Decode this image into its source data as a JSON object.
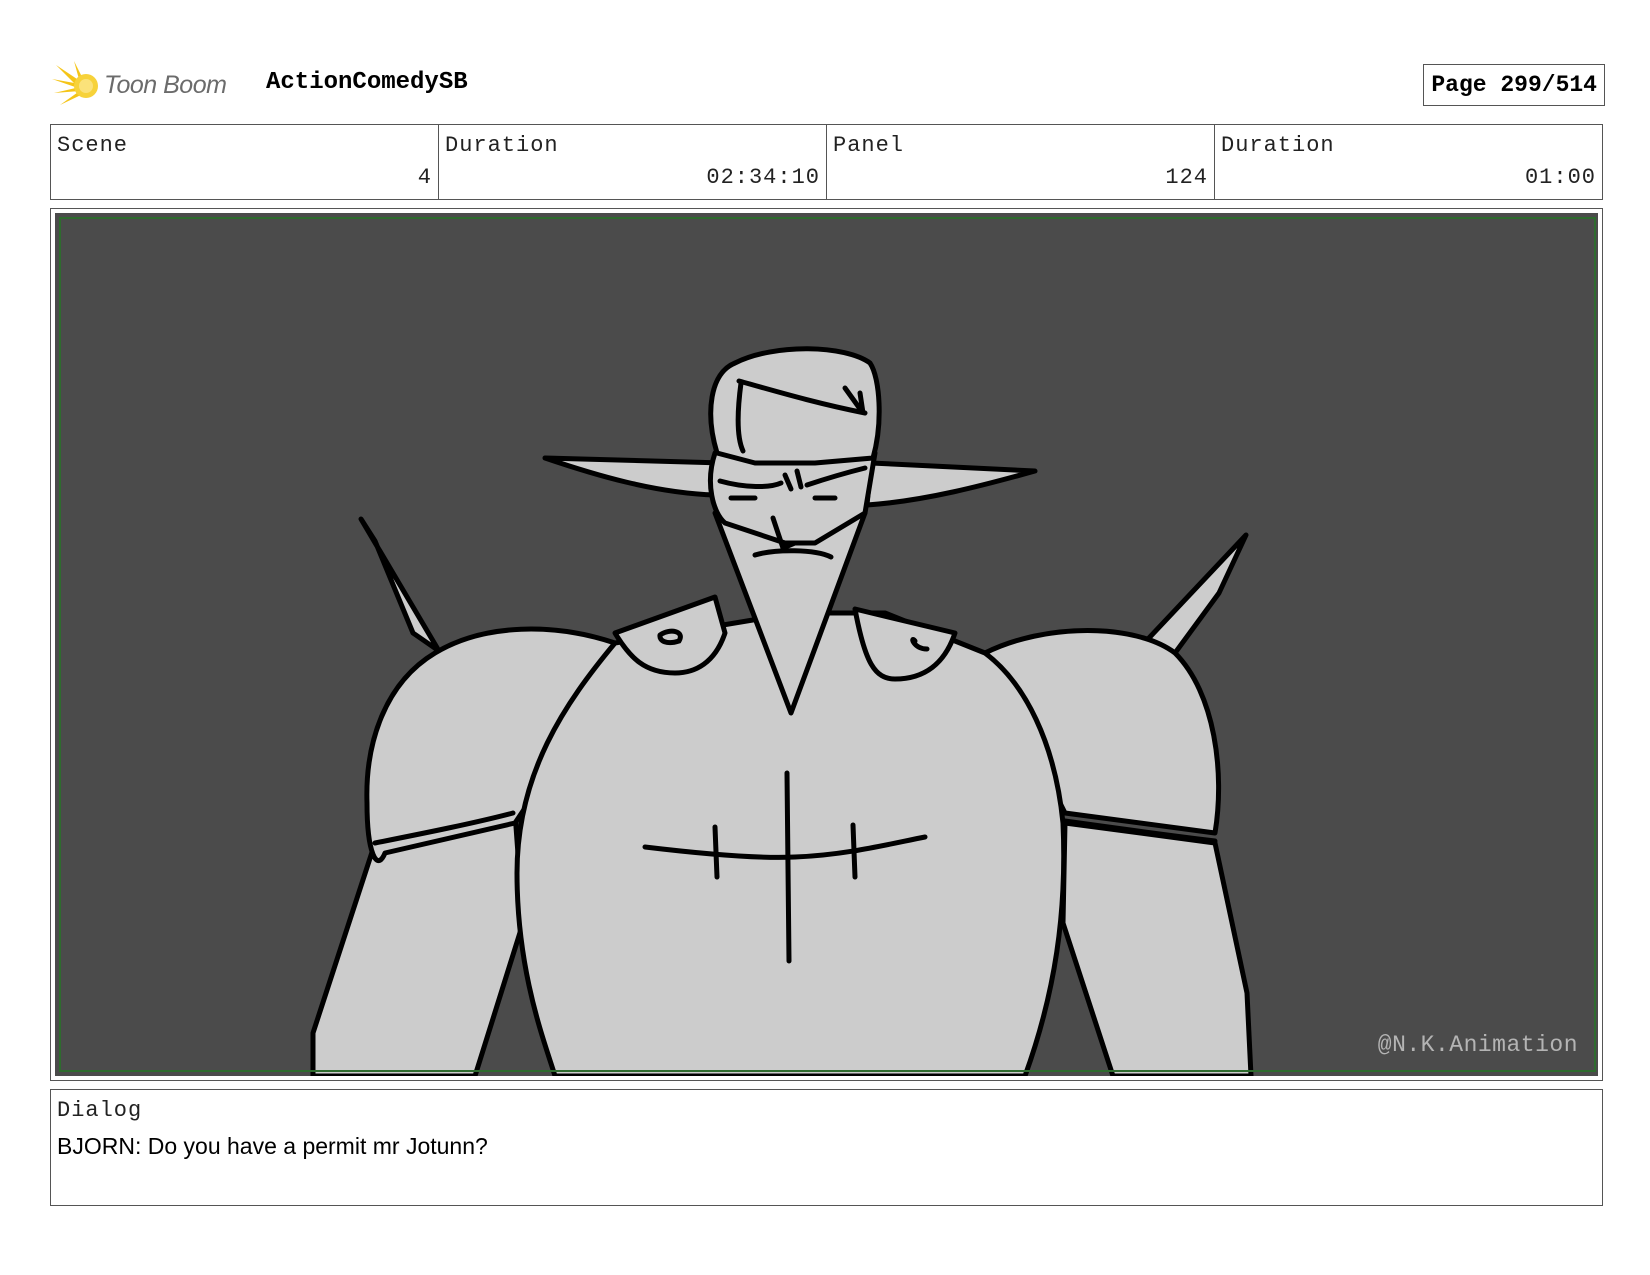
{
  "header": {
    "logo_text": "Toon Boom",
    "project_title": "ActionComedySB",
    "page_label": "Page 299/514"
  },
  "info": {
    "scene_label": "Scene",
    "scene_value": "4",
    "scene_duration_label": "Duration",
    "scene_duration_value": "02:34:10",
    "panel_label": "Panel",
    "panel_value": "124",
    "panel_duration_label": "Duration",
    "panel_duration_value": "01:00"
  },
  "panel": {
    "watermark": "@N.K.Animation",
    "background_color": "#4b4b4b",
    "character_fill": "#cccccc",
    "safe_frame_color": "#2e6b2e"
  },
  "dialog": {
    "label": "Dialog",
    "text": "BJORN: Do you have a permit mr Jotunn?"
  }
}
